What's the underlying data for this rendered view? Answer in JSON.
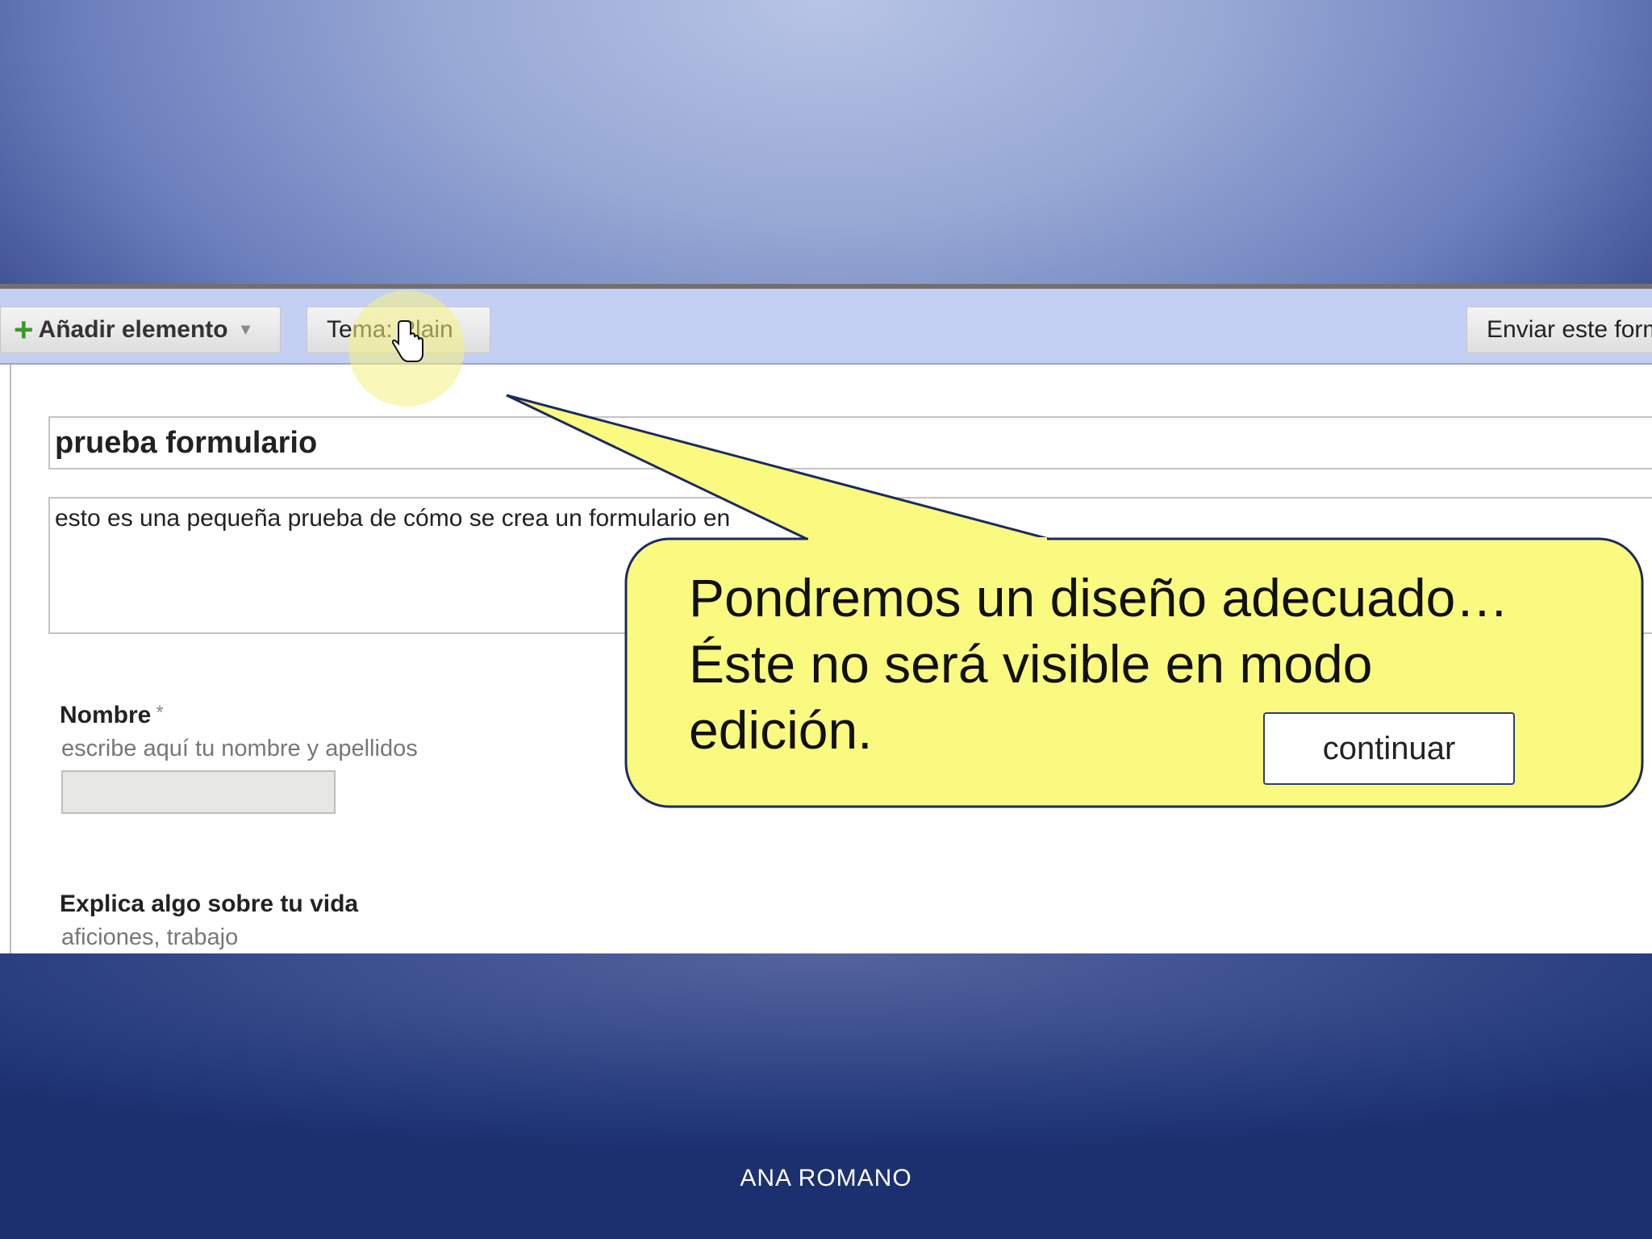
{
  "toolbar": {
    "add_label": "Añadir elemento",
    "theme_label": "Tema: Plain",
    "send_label": "Enviar este form"
  },
  "form": {
    "title": "prueba formulario",
    "description": "esto es una pequeña prueba de cómo se crea un formulario en",
    "questions": [
      {
        "label": "Nombre",
        "required_mark": "*",
        "help": "escribe aquí tu nombre y apellidos"
      },
      {
        "label": "Explica algo sobre tu vida",
        "help": "aficiones, trabajo"
      }
    ]
  },
  "callout": {
    "line1": "Pondremos un diseño adecuado…",
    "line2": "Éste no será visible en modo",
    "line3": "edición.",
    "continue_label": "continuar"
  },
  "footer": {
    "author": "ANA ROMANO"
  },
  "colors": {
    "callout_fill": "#fafa80",
    "toolbar_bg": "#c3d0f4",
    "slide_dark": "#1c3070"
  },
  "icons": [
    "plus-icon",
    "dropdown-caret-icon",
    "hand-cursor-icon"
  ]
}
